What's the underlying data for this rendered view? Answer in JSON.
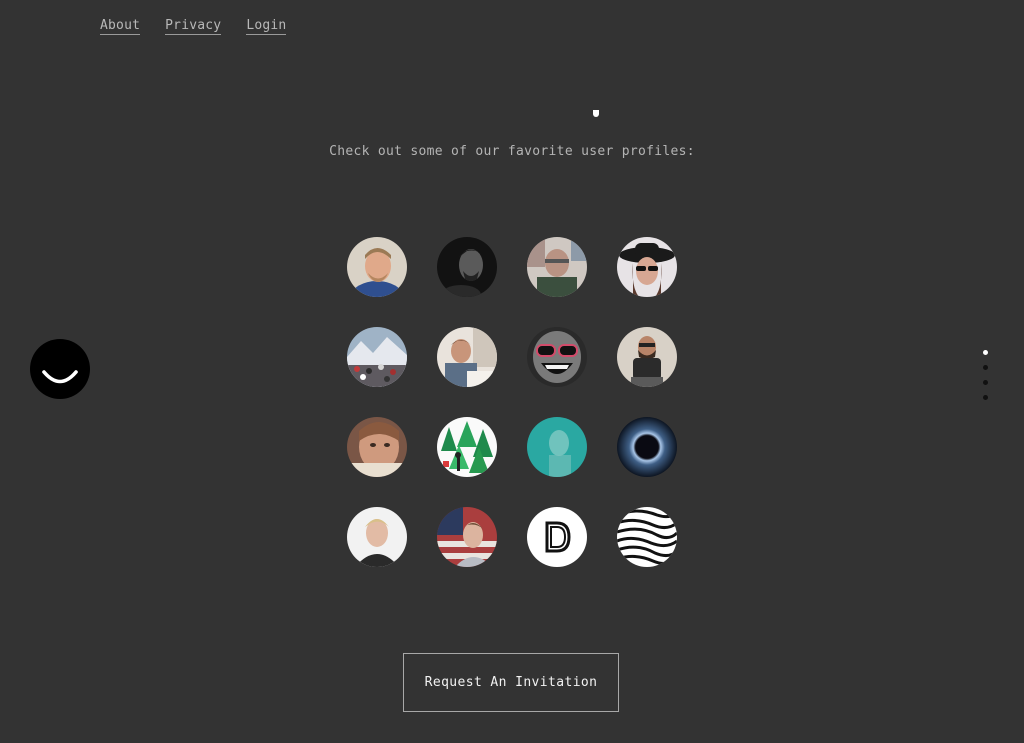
{
  "nav": {
    "about": "About",
    "privacy": "Privacy",
    "login": "Login"
  },
  "subtitle": "Check out some of our favorite user profiles:",
  "cta": {
    "label": "Request An Invitation"
  },
  "pager": {
    "count": 4,
    "active_index": 0
  },
  "profiles": [
    {
      "name": "profile-1",
      "icon": "smiling-man-blue-shirt-photo"
    },
    {
      "name": "profile-2",
      "icon": "man-black-and-white-photo"
    },
    {
      "name": "profile-3",
      "icon": "man-in-room-photo"
    },
    {
      "name": "profile-4",
      "icon": "woman-hat-sunglasses-photo"
    },
    {
      "name": "profile-5",
      "icon": "mountain-crowd-photo"
    },
    {
      "name": "profile-6",
      "icon": "man-drawing-photo"
    },
    {
      "name": "profile-7",
      "icon": "laughing-face-glasses-illustration"
    },
    {
      "name": "profile-8",
      "icon": "man-seated-photo"
    },
    {
      "name": "profile-9",
      "icon": "woman-closeup-photo"
    },
    {
      "name": "profile-10",
      "icon": "pine-trees-illustration"
    },
    {
      "name": "profile-11",
      "icon": "teal-portrait-photo"
    },
    {
      "name": "profile-12",
      "icon": "eclipse-photo"
    },
    {
      "name": "profile-13",
      "icon": "blond-man-photo"
    },
    {
      "name": "profile-14",
      "icon": "man-flag-background-photo"
    },
    {
      "name": "profile-15",
      "icon": "letter-d-logo"
    },
    {
      "name": "profile-16",
      "icon": "zebra-pattern-illustration"
    }
  ],
  "colors": {
    "background": "#333333",
    "text": "#b4b4b4",
    "button_border": "#a8a8a8",
    "logo": "#000000"
  }
}
